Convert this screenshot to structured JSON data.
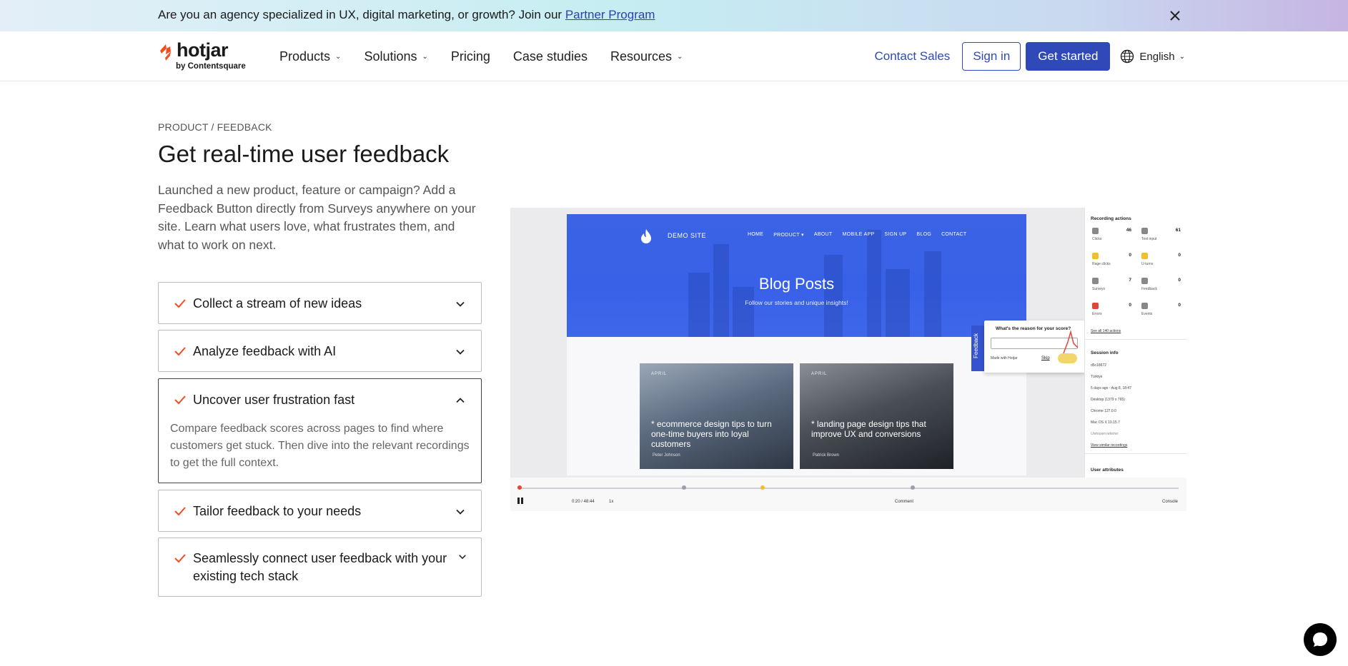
{
  "banner": {
    "text": "Are you an agency specialized in UX, digital marketing, or growth? Join our ",
    "link": "Partner Program"
  },
  "header": {
    "logo_word": "hotjar",
    "logo_by": "by Contentsquare",
    "nav": [
      "Products",
      "Solutions",
      "Pricing",
      "Case studies",
      "Resources"
    ],
    "contact": "Contact Sales",
    "sign_in": "Sign in",
    "get_started": "Get started",
    "language": "English"
  },
  "hero": {
    "breadcrumb": "PRODUCT / FEEDBACK",
    "title": "Get real-time user feedback",
    "description": "Launched a new product, feature or campaign? Add a Feedback Button directly from Surveys anywhere on your site. Learn what users love, what frustrates them, and what to work on next."
  },
  "accordion": [
    {
      "label": "Collect a stream of new ideas",
      "open": false
    },
    {
      "label": "Analyze feedback with AI",
      "open": false
    },
    {
      "label": "Uncover user frustration fast",
      "open": true,
      "body": "Compare feedback scores across pages to find where customers get stuck. Then dive into the relevant recordings to get the full context."
    },
    {
      "label": "Tailor feedback to your needs",
      "open": false
    },
    {
      "label": "Seamlessly connect user feedback with your existing tech stack",
      "open": false
    }
  ],
  "demo": {
    "site_name": "DEMO SITE",
    "site_nav": [
      "HOME",
      "PRODUCT ▾",
      "ABOUT",
      "MOBILE APP",
      "SIGN UP",
      "BLOG",
      "CONTACT"
    ],
    "blog_title": "Blog Posts",
    "blog_sub": "Follow our stories and unique insights!",
    "card1": {
      "date": "APRIL",
      "text": "* ecommerce design tips to turn one-time buyers into loyal customers",
      "author": "Peter Johnson"
    },
    "card2": {
      "date": "APRIL",
      "text": "* landing page design tips that improve UX and conversions",
      "author": "Patrick Brown"
    },
    "feedback_tab": "Feedback",
    "feedback_question": "What's the reason for your score?",
    "feedback_made": "Made with Hotjar",
    "feedback_skip": "Skip",
    "panel": {
      "recording_actions": "Recording actions",
      "actions": [
        {
          "label": "Clicks",
          "value": "46",
          "color": "#9aa0aa"
        },
        {
          "label": "Text input",
          "value": "61",
          "color": "#9aa0aa"
        },
        {
          "label": "Rage clicks",
          "value": "0",
          "color": "#f0c02a"
        },
        {
          "label": "U-turns",
          "value": "0",
          "color": "#f0c02a"
        },
        {
          "label": "Surveys",
          "value": "7",
          "color": "#9aa0aa"
        },
        {
          "label": "Feedback",
          "value": "0",
          "color": "#9aa0aa"
        },
        {
          "label": "Errors",
          "value": "0",
          "color": "#e0453a"
        },
        {
          "label": "Events",
          "value": "0",
          "color": "#9aa0aa"
        }
      ],
      "see_all": "See all 140 actions",
      "session_info": "Session info",
      "session": [
        "d5c18672",
        "Türkiye",
        "5 days ago - Aug 8, 18:47",
        "Desktop (1379 x 765)",
        "Chrome 127.0.0",
        "Mac OS X 10.15.7",
        "Unknown referrer"
      ],
      "view_similar": "View similar recordings",
      "user_attributes": "User attributes"
    },
    "player": {
      "time": "0:20 / 48:44",
      "speed": "1x",
      "comment": "Comment",
      "console": "Console"
    }
  }
}
